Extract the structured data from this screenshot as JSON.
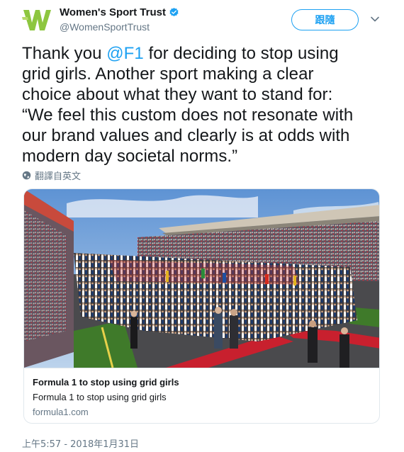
{
  "author": {
    "display_name": "Women's Sport Trust",
    "handle": "@WomenSportTrust",
    "avatar_icon": "wst-logo-icon",
    "verified_icon": "verified-badge-icon"
  },
  "actions": {
    "follow_label": "跟隨",
    "menu_icon": "chevron-down-icon"
  },
  "tweet": {
    "line1_pre": "Thank you ",
    "mention": "@F1",
    "line1_post": " for deciding to stop using",
    "line2": "grid girls. Another sport making a clear",
    "line3": "choice about what they want to stand for:",
    "line4": "“We feel this custom does not resonate with",
    "line5": "our brand values and clearly is at odds with",
    "line6": "modern day societal norms.”"
  },
  "translate": {
    "label": "翻譯自英文",
    "icon": "globe-icon"
  },
  "card": {
    "title": "Formula 1 to stop using grid girls",
    "description": "Formula 1 to stop using grid girls",
    "domain": "formula1.com"
  },
  "timestamp": "上午5:57 - 2018年1月31日",
  "colors": {
    "accent": "#1da1f2",
    "logo_green": "#8dc63f",
    "muted": "#657786"
  }
}
